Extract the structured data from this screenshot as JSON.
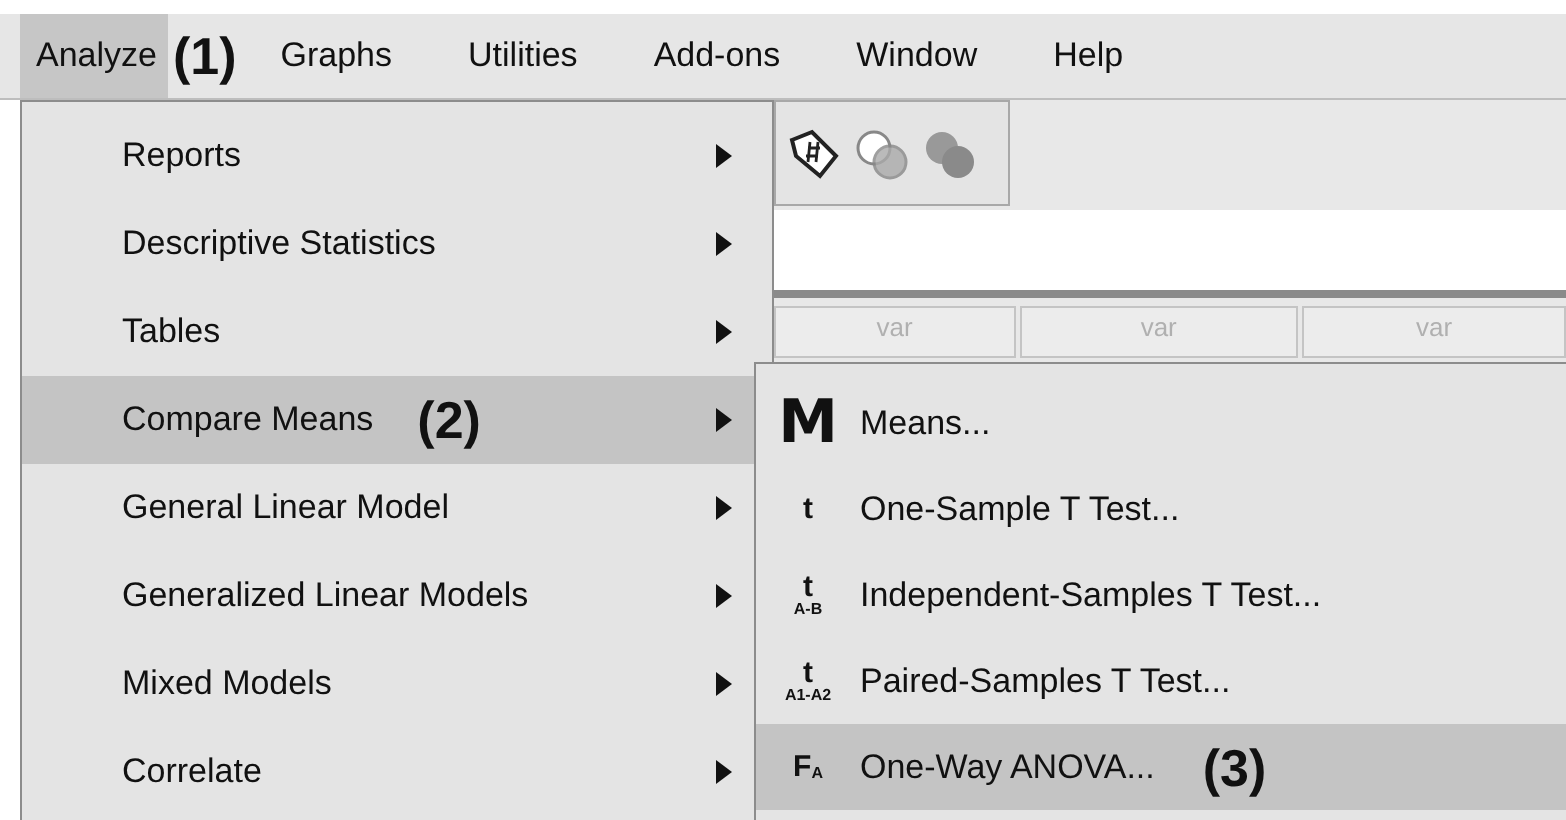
{
  "menubar": [
    {
      "label": "Analyze",
      "selected": true
    },
    {
      "label": "Graphs",
      "selected": false
    },
    {
      "label": "Utilities",
      "selected": false
    },
    {
      "label": "Add-ons",
      "selected": false
    },
    {
      "label": "Window",
      "selected": false
    },
    {
      "label": "Help",
      "selected": false
    }
  ],
  "callouts": [
    "(1)",
    "(2)",
    "(3)"
  ],
  "grid_headers": [
    "var",
    "var",
    "var"
  ],
  "analyze_menu": [
    {
      "label": "Reports",
      "selected": false
    },
    {
      "label": "Descriptive Statistics",
      "selected": false
    },
    {
      "label": "Tables",
      "selected": false
    },
    {
      "label": "Compare Means",
      "selected": true
    },
    {
      "label": "General Linear Model",
      "selected": false
    },
    {
      "label": "Generalized Linear Models",
      "selected": false
    },
    {
      "label": "Mixed Models",
      "selected": false
    },
    {
      "label": "Correlate",
      "selected": false
    }
  ],
  "compare_means_menu": [
    {
      "label": "Means...",
      "icon": "M",
      "selected": false
    },
    {
      "label": "One-Sample T Test...",
      "icon": "t",
      "selected": false
    },
    {
      "label": "Independent-Samples T Test...",
      "icon": "t",
      "icon_sub": "A-B",
      "selected": false
    },
    {
      "label": "Paired-Samples T Test...",
      "icon": "t",
      "icon_sub": "A1-A2",
      "selected": false
    },
    {
      "label": "One-Way ANOVA...",
      "icon": "F",
      "icon_sub": "A",
      "selected": true
    }
  ]
}
